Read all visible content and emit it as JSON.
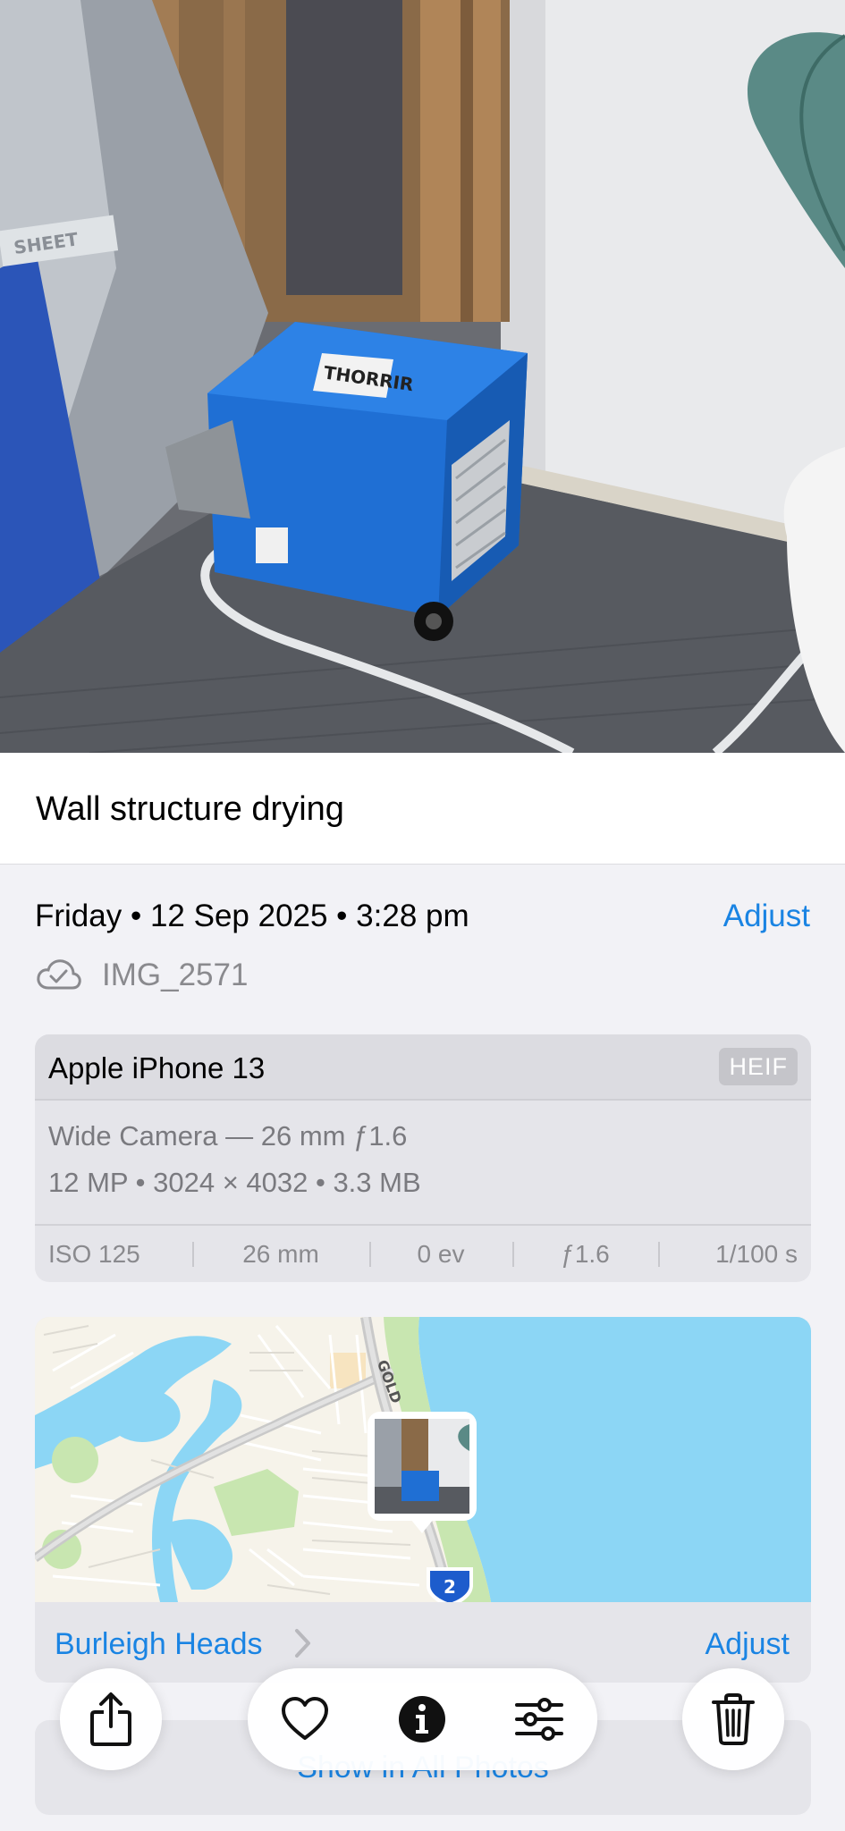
{
  "photo": {
    "description_icon": "photo-image",
    "label_on_unit": "THORRIR"
  },
  "caption": "Wall structure drying",
  "info": {
    "date_line": "Friday • 12 Sep 2025 • 3:28 pm",
    "adjust_label": "Adjust",
    "cloud_icon": "icloud-check-icon",
    "file_name": "IMG_2571"
  },
  "device": {
    "name": "Apple iPhone 13",
    "format_badge": "HEIF",
    "lens": "Wide Camera — 26 mm ƒ1.6",
    "specs": "12 MP • 3024 × 4032 • 3.3 MB",
    "exif": [
      "ISO 125",
      "26 mm",
      "0 ev",
      "ƒ1.6",
      "1/100 s"
    ]
  },
  "map": {
    "road_label": "GOLD",
    "route_shield": "2",
    "place_name": "Burleigh Heads",
    "adjust_label": "Adjust",
    "colors": {
      "water": "#8cd6f5",
      "land": "#f6f3ea",
      "park": "#c8e6b0",
      "road": "#c9c9c9"
    }
  },
  "show_all_label": "Show in All Photos",
  "toolbar": {
    "share_icon": "share-icon",
    "favorite_icon": "heart-icon",
    "info_icon": "info-icon",
    "edit_icon": "sliders-icon",
    "delete_icon": "trash-icon"
  },
  "colors": {
    "accent": "#1a84e3",
    "sheet": "#f2f2f6",
    "card": "#e5e5ea"
  }
}
